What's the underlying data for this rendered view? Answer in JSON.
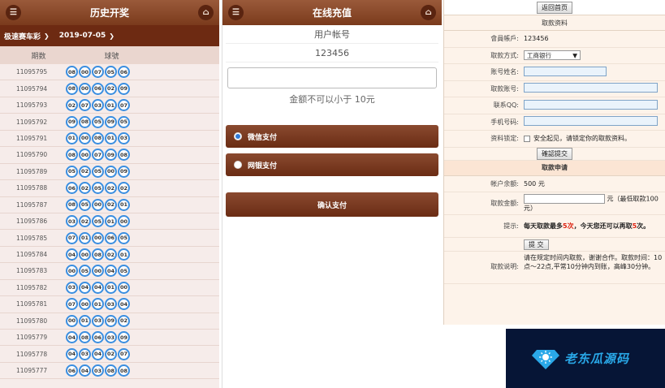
{
  "history": {
    "title": "历史开奖",
    "lottery_select": "极速赛车彩",
    "date_select": "2019-07-05",
    "col_issue": "期数",
    "col_numbers": "球號",
    "rows": [
      {
        "issue": "11095795",
        "balls": [
          "08",
          "00",
          "07",
          "05",
          "06"
        ]
      },
      {
        "issue": "11095794",
        "balls": [
          "08",
          "00",
          "06",
          "02",
          "09"
        ]
      },
      {
        "issue": "11095793",
        "balls": [
          "02",
          "07",
          "03",
          "01",
          "07"
        ]
      },
      {
        "issue": "11095792",
        "balls": [
          "09",
          "08",
          "05",
          "09",
          "05"
        ]
      },
      {
        "issue": "11095791",
        "balls": [
          "01",
          "00",
          "08",
          "01",
          "03"
        ]
      },
      {
        "issue": "11095790",
        "balls": [
          "08",
          "00",
          "07",
          "09",
          "08"
        ]
      },
      {
        "issue": "11095789",
        "balls": [
          "05",
          "02",
          "05",
          "00",
          "09"
        ]
      },
      {
        "issue": "11095788",
        "balls": [
          "06",
          "02",
          "05",
          "02",
          "02"
        ]
      },
      {
        "issue": "11095787",
        "balls": [
          "08",
          "05",
          "00",
          "02",
          "01"
        ]
      },
      {
        "issue": "11095786",
        "balls": [
          "03",
          "02",
          "05",
          "01",
          "00"
        ]
      },
      {
        "issue": "11095785",
        "balls": [
          "07",
          "01",
          "00",
          "06",
          "05"
        ]
      },
      {
        "issue": "11095784",
        "balls": [
          "04",
          "00",
          "08",
          "02",
          "01"
        ]
      },
      {
        "issue": "11095783",
        "balls": [
          "00",
          "05",
          "00",
          "04",
          "05"
        ]
      },
      {
        "issue": "11095782",
        "balls": [
          "03",
          "04",
          "04",
          "01",
          "00"
        ]
      },
      {
        "issue": "11095781",
        "balls": [
          "07",
          "00",
          "01",
          "03",
          "04"
        ]
      },
      {
        "issue": "11095780",
        "balls": [
          "00",
          "01",
          "03",
          "09",
          "02"
        ]
      },
      {
        "issue": "11095779",
        "balls": [
          "04",
          "08",
          "06",
          "03",
          "09"
        ]
      },
      {
        "issue": "11095778",
        "balls": [
          "04",
          "03",
          "04",
          "02",
          "07"
        ]
      },
      {
        "issue": "11095777",
        "balls": [
          "06",
          "04",
          "03",
          "08",
          "08"
        ]
      }
    ]
  },
  "recharge": {
    "title": "在线充值",
    "account_label": "用户帐号",
    "account_value": "123456",
    "amount_placeholder": "",
    "min_notice": "金额不可以小于 10元",
    "pay_wechat": "微信支付",
    "pay_bank": "网银支付",
    "confirm": "确认支付"
  },
  "withdraw": {
    "back_button": "返回首页",
    "section_info": "取款资料",
    "member_label": "會員帳戶:",
    "member_value": "123456",
    "method_label": "取款方式:",
    "method_value": "工商银行",
    "name_label": "账号姓名:",
    "account_label": "取款账号:",
    "qq_label": "联系QQ:",
    "phone_label": "手机号码:",
    "lock_label": "资料锁定:",
    "lock_text": "安全起见，请锁定你的取款资料。",
    "confirm_submit": "確認提交",
    "section_apply": "取款申请",
    "balance_label": "帐户余额:",
    "balance_value": "500 元",
    "amount_label": "取款金额:",
    "amount_hint": "元（最低取款100元）",
    "tip_label": "提示:",
    "tip_text_a": "每天取款最多",
    "tip_text_b": "5次",
    "tip_text_c": "，今天您还可以再取",
    "tip_text_d": "5",
    "tip_text_e": "次。",
    "submit": "提 交",
    "desc_label": "取款说明:",
    "desc_text": "请在规定时间内取款，谢谢合作。取款时间：10点～22点,平常10分钟内到账，高峰30分钟。"
  },
  "watermark": {
    "text": "老东瓜源码"
  }
}
